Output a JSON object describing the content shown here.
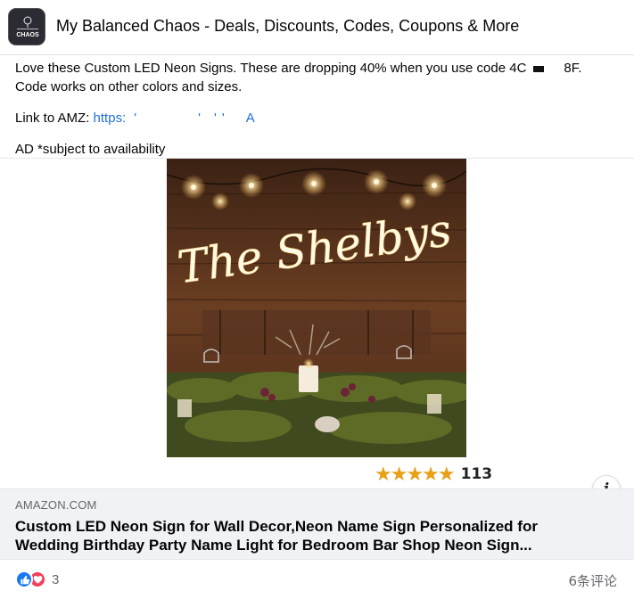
{
  "header": {
    "page_name": "My Balanced Chaos - Deals, Discounts, Codes, Coupons & More",
    "avatar_text": "CHAOS"
  },
  "post": {
    "line1": "Love these Custom LED Neon Signs.  These are dropping 40% when you use code 4C",
    "line1_end": "8F.",
    "line2": "Code works on other colors and sizes.",
    "link_label": "Link to AMZ:",
    "link_start": "https:",
    "link_end": "A",
    "ad_note": "AD *subject to availability"
  },
  "product": {
    "sign_text": "The Shelbys",
    "stars": "★★★★★",
    "rating_count": "113"
  },
  "link_card": {
    "domain": "AMAZON.COM",
    "title": "Custom LED Neon Sign for Wall Decor,Neon Name Sign Personalized for Wedding Birthday Party Name Light for Bedroom Bar Shop Neon Sign..."
  },
  "footer": {
    "reaction_count": "3",
    "comments": "6条评论"
  },
  "colors": {
    "link": "#216fdb",
    "like": "#1877f2",
    "love": "#f33e58",
    "star": "#e8a019"
  }
}
